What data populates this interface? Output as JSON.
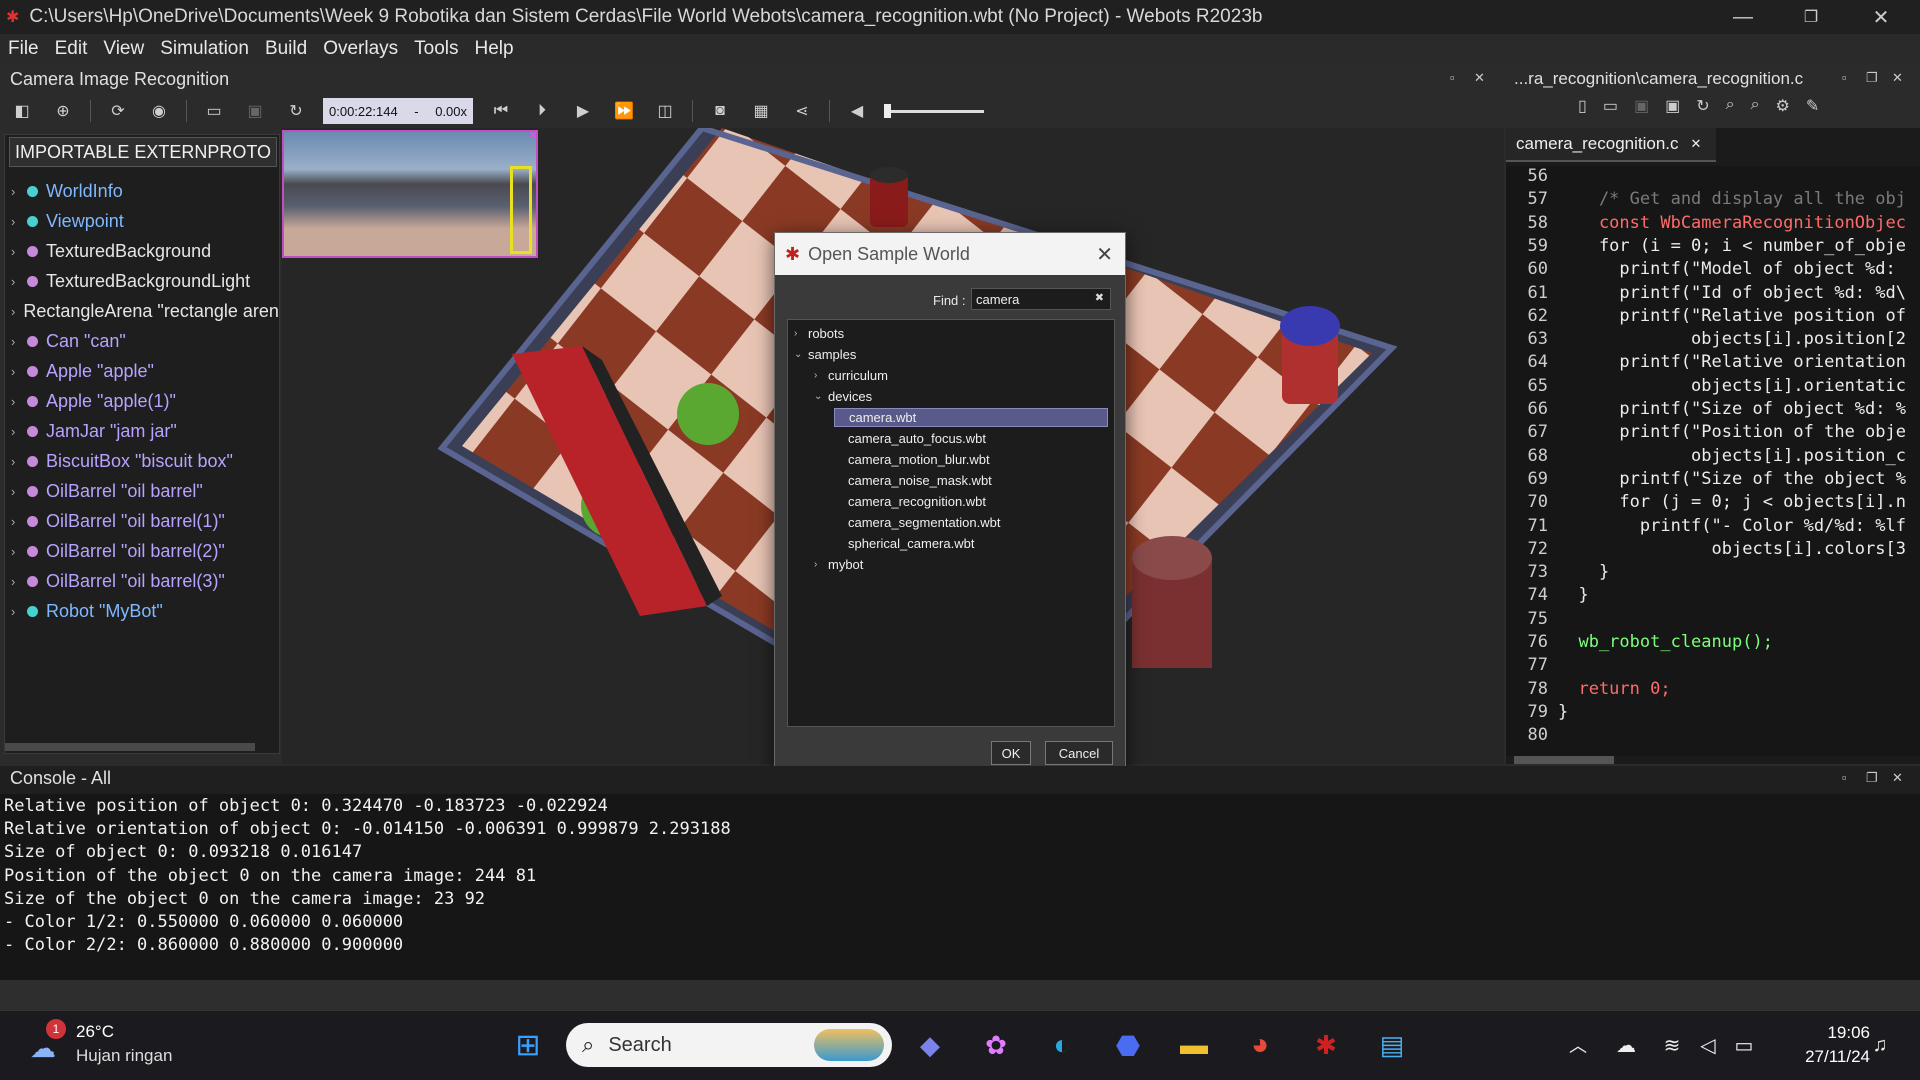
{
  "window": {
    "title": "C:\\Users\\Hp\\OneDrive\\Documents\\Week 9 Robotika dan Sistem Cerdas\\File World Webots\\camera_recognition.wbt (No Project) - Webots R2023b"
  },
  "menu": [
    "File",
    "Edit",
    "View",
    "Simulation",
    "Build",
    "Overlays",
    "Tools",
    "Help"
  ],
  "left_panel": {
    "title": "Camera Image Recognition",
    "proto_button": "IMPORTABLE EXTERNPROTO",
    "nodes": [
      {
        "label": "WorldInfo",
        "color": "#4ad0d0",
        "text_color": "#7fb8ff"
      },
      {
        "label": "Viewpoint",
        "color": "#4ad0d0",
        "text_color": "#7fb8ff"
      },
      {
        "label": "TexturedBackground",
        "color": "#c58ad9",
        "text_color": "#e6e6e6"
      },
      {
        "label": "TexturedBackgroundLight",
        "color": "#c58ad9",
        "text_color": "#e6e6e6"
      },
      {
        "label": "RectangleArena \"rectangle arena\"",
        "color": "#c58ad9",
        "text_color": "#e6e6e6"
      },
      {
        "label": "Can \"can\"",
        "color": "#c58ad9",
        "text_color": "#b9a2ff"
      },
      {
        "label": "Apple \"apple\"",
        "color": "#c58ad9",
        "text_color": "#b9a2ff"
      },
      {
        "label": "Apple \"apple(1)\"",
        "color": "#c58ad9",
        "text_color": "#b9a2ff"
      },
      {
        "label": "JamJar \"jam jar\"",
        "color": "#c58ad9",
        "text_color": "#b9a2ff"
      },
      {
        "label": "BiscuitBox \"biscuit box\"",
        "color": "#c58ad9",
        "text_color": "#b9a2ff"
      },
      {
        "label": "OilBarrel \"oil barrel\"",
        "color": "#c58ad9",
        "text_color": "#b9a2ff"
      },
      {
        "label": "OilBarrel \"oil barrel(1)\"",
        "color": "#c58ad9",
        "text_color": "#b9a2ff"
      },
      {
        "label": "OilBarrel \"oil barrel(2)\"",
        "color": "#c58ad9",
        "text_color": "#b9a2ff"
      },
      {
        "label": "OilBarrel \"oil barrel(3)\"",
        "color": "#c58ad9",
        "text_color": "#b9a2ff"
      },
      {
        "label": "Robot \"MyBot\"",
        "color": "#4ad0d0",
        "text_color": "#7fb8ff"
      }
    ]
  },
  "toolbar": {
    "time": "0:00:22:144",
    "speed_sep": "-",
    "speed": "0.00x"
  },
  "editor": {
    "path_title": "...ra_recognition\\camera_recognition.c",
    "tab": "camera_recognition.c",
    "lines": [
      {
        "n": "56",
        "t": ""
      },
      {
        "n": "57",
        "t": "    /* Get and display all the obj",
        "c": "#7a7a7a"
      },
      {
        "n": "58",
        "t": "    const WbCameraRecognitionObjec",
        "c": "#ff6b6b"
      },
      {
        "n": "59",
        "t": "    for (i = 0; i < number_of_obje"
      },
      {
        "n": "60",
        "t": "      printf(\"Model of object %d: "
      },
      {
        "n": "61",
        "t": "      printf(\"Id of object %d: %d\\"
      },
      {
        "n": "62",
        "t": "      printf(\"Relative position of"
      },
      {
        "n": "63",
        "t": "             objects[i].position[2"
      },
      {
        "n": "64",
        "t": "      printf(\"Relative orientation"
      },
      {
        "n": "65",
        "t": "             objects[i].orientatic"
      },
      {
        "n": "66",
        "t": "      printf(\"Size of object %d: %"
      },
      {
        "n": "67",
        "t": "      printf(\"Position of the obje"
      },
      {
        "n": "68",
        "t": "             objects[i].position_c"
      },
      {
        "n": "69",
        "t": "      printf(\"Size of the object %"
      },
      {
        "n": "70",
        "t": "      for (j = 0; j < objects[i].n"
      },
      {
        "n": "71",
        "t": "        printf(\"- Color %d/%d: %lf"
      },
      {
        "n": "72",
        "t": "               objects[i].colors[3"
      },
      {
        "n": "73",
        "t": "    }"
      },
      {
        "n": "74",
        "t": "  }"
      },
      {
        "n": "75",
        "t": ""
      },
      {
        "n": "76",
        "t": "  wb_robot_cleanup();",
        "c": "#7cff7c"
      },
      {
        "n": "77",
        "t": ""
      },
      {
        "n": "78",
        "t": "  return 0;",
        "c": "#ff6b6b"
      },
      {
        "n": "79",
        "t": "}"
      },
      {
        "n": "80",
        "t": ""
      }
    ]
  },
  "console": {
    "title": "Console - All",
    "lines": [
      "Relative position of object 0: 0.324470 -0.183723 -0.022924",
      "Relative orientation of object 0: -0.014150 -0.006391 0.999879 2.293188",
      "Size of object 0: 0.093218 0.016147",
      "Position of the object 0 on the camera image: 244 81",
      "Size of the object 0 on the camera image: 23 92",
      "- Color 1/2: 0.550000 0.060000 0.060000",
      "- Color 2/2: 0.860000 0.880000 0.900000"
    ]
  },
  "dialog": {
    "title": "Open Sample World",
    "find_label": "Find :",
    "find_value": "camera",
    "tree": [
      {
        "label": "robots",
        "depth": 0,
        "chev": "›"
      },
      {
        "label": "samples",
        "depth": 0,
        "chev": "⌄"
      },
      {
        "label": "curriculum",
        "depth": 1,
        "chev": "›"
      },
      {
        "label": "devices",
        "depth": 1,
        "chev": "⌄"
      },
      {
        "label": "camera.wbt",
        "depth": 2,
        "chev": "",
        "selected": true
      },
      {
        "label": "camera_auto_focus.wbt",
        "depth": 2,
        "chev": ""
      },
      {
        "label": "camera_motion_blur.wbt",
        "depth": 2,
        "chev": ""
      },
      {
        "label": "camera_noise_mask.wbt",
        "depth": 2,
        "chev": ""
      },
      {
        "label": "camera_recognition.wbt",
        "depth": 2,
        "chev": ""
      },
      {
        "label": "camera_segmentation.wbt",
        "depth": 2,
        "chev": ""
      },
      {
        "label": "spherical_camera.wbt",
        "depth": 2,
        "chev": ""
      },
      {
        "label": "mybot",
        "depth": 1,
        "chev": "›"
      }
    ],
    "ok": "OK",
    "cancel": "Cancel"
  },
  "taskbar": {
    "weather_temp": "26°C",
    "weather_desc": "Hujan ringan",
    "weather_badge": "1",
    "search_label": "Search",
    "time": "19:06",
    "date": "27/11/24"
  }
}
